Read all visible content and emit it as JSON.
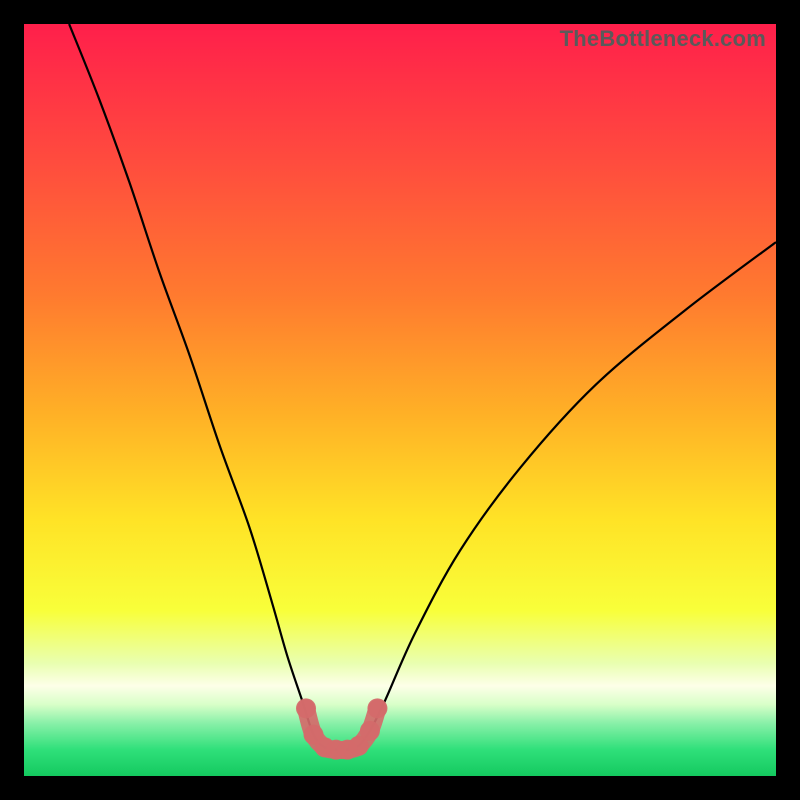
{
  "watermark": "TheBottleneck.com",
  "chart_data": {
    "type": "line",
    "title": "",
    "xlabel": "",
    "ylabel": "",
    "xlim": [
      0,
      100
    ],
    "ylim": [
      0,
      100
    ],
    "curve": {
      "name": "bottleneck-curve",
      "x": [
        6,
        10,
        14,
        18,
        22,
        26,
        30,
        33,
        35,
        37,
        38.5,
        40,
        41.5,
        43,
        44.5,
        46,
        48,
        52,
        58,
        66,
        76,
        88,
        100
      ],
      "y": [
        100,
        90,
        79,
        67,
        56,
        44,
        33,
        23,
        16,
        10,
        5.5,
        3.8,
        3.5,
        3.5,
        4.0,
        6.0,
        10,
        19,
        30,
        41,
        52,
        62,
        71
      ]
    },
    "markers": {
      "name": "min-region",
      "color": "#d46a6a",
      "x": [
        37.5,
        38.5,
        40,
        41.5,
        43,
        44.5,
        46,
        47
      ],
      "y": [
        9,
        5.5,
        3.8,
        3.5,
        3.5,
        4.0,
        6.0,
        9
      ]
    },
    "gradient_stops": [
      {
        "offset": 0.0,
        "color": "#ff1f4b"
      },
      {
        "offset": 0.18,
        "color": "#ff4b3e"
      },
      {
        "offset": 0.36,
        "color": "#ff7a2f"
      },
      {
        "offset": 0.52,
        "color": "#ffb126"
      },
      {
        "offset": 0.66,
        "color": "#ffe326"
      },
      {
        "offset": 0.78,
        "color": "#f8ff3a"
      },
      {
        "offset": 0.85,
        "color": "#e9ffb0"
      },
      {
        "offset": 0.88,
        "color": "#fdffe8"
      },
      {
        "offset": 0.905,
        "color": "#d8ffc8"
      },
      {
        "offset": 0.93,
        "color": "#88f0a8"
      },
      {
        "offset": 0.965,
        "color": "#2fe07a"
      },
      {
        "offset": 1.0,
        "color": "#14c95f"
      }
    ]
  }
}
